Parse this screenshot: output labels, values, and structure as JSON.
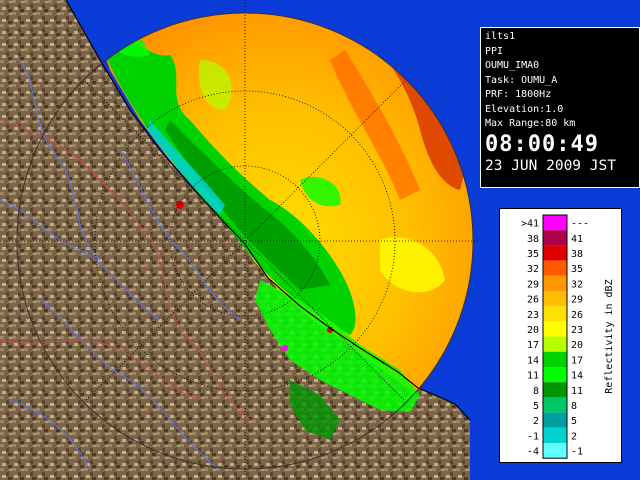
{
  "info": {
    "radar_name": "ilts1",
    "scan_type": "PPI",
    "product_name": "OUMU_IMA0",
    "task": "Task: OUMU_A",
    "prf": "PRF: 1800Hz",
    "elevation": "Elevation:1.0",
    "max_range": "Max Range:80 km",
    "time": "08:00:49",
    "date": "23 JUN 2009 JST"
  },
  "legend": {
    "axis_label": "Reflectivity in dBZ",
    "rows": [
      {
        "left": ">41",
        "right": "---",
        "color": "#ff00ff"
      },
      {
        "left": "38",
        "right": "41",
        "color": "#b0004a"
      },
      {
        "left": "35",
        "right": "38",
        "color": "#e00000"
      },
      {
        "left": "32",
        "right": "35",
        "color": "#ff5a00"
      },
      {
        "left": "29",
        "right": "32",
        "color": "#ff9600"
      },
      {
        "left": "26",
        "right": "29",
        "color": "#ffbe00"
      },
      {
        "left": "23",
        "right": "26",
        "color": "#ffe000"
      },
      {
        "left": "20",
        "right": "23",
        "color": "#ffff00"
      },
      {
        "left": "17",
        "right": "20",
        "color": "#b4ff00"
      },
      {
        "left": "14",
        "right": "17",
        "color": "#00d200"
      },
      {
        "left": "11",
        "right": "14",
        "color": "#00ff00"
      },
      {
        "left": "8",
        "right": "11",
        "color": "#009600"
      },
      {
        "left": "5",
        "right": "8",
        "color": "#00c864"
      },
      {
        "left": "2",
        "right": "5",
        "color": "#00a0a0"
      },
      {
        "left": "-1",
        "right": "2",
        "color": "#00d2d2"
      },
      {
        "left": "-4",
        "right": "-1",
        "color": "#64ffff"
      }
    ]
  },
  "colors": {
    "sea": "#0a3bd6",
    "land": "#7b6546",
    "range_ring": "#000000",
    "coastline": "#000000",
    "rivers": "#5a78ff",
    "borders": "#c85050"
  },
  "icons": [
    "radar-echo-image",
    "terrain-map"
  ]
}
